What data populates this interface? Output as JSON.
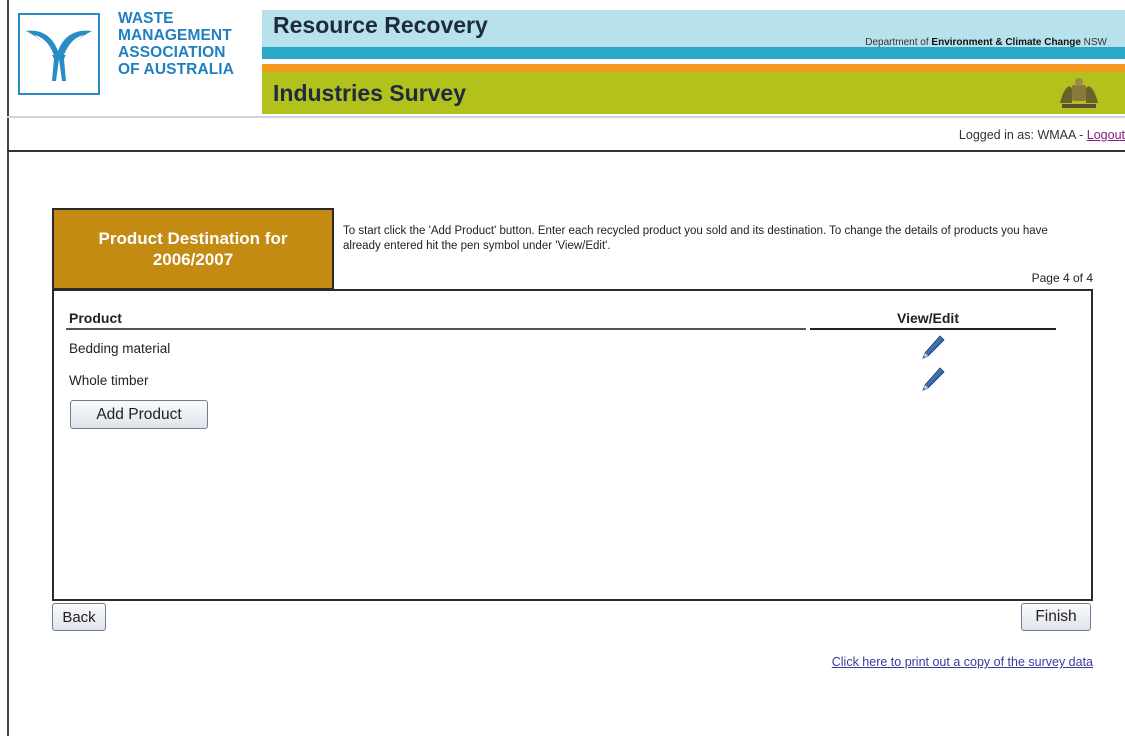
{
  "header": {
    "org_name_lines": [
      "WASTE",
      "MANAGEMENT",
      "ASSOCIATION",
      "OF AUSTRALIA"
    ],
    "title_top": "Resource Recovery",
    "title_bottom": "Industries Survey",
    "dept_prefix": "Department of ",
    "dept_bold": "Environment & Climate Change",
    "dept_suffix": " NSW",
    "logo_icon": "wmaa-logo-icon",
    "crest_icon": "nsw-crest-icon"
  },
  "session": {
    "logged_in_prefix": "Logged in as: WMAA - ",
    "logout_label": "Logout"
  },
  "panel": {
    "title": "Product Destination for 2006/2007",
    "instructions": "To start click the 'Add Product' button. Enter each recycled product you sold and its destination. To change the details of products you have already entered hit the pen symbol under 'View/Edit'.",
    "page_indicator": "Page 4 of 4"
  },
  "table": {
    "columns": [
      "Product",
      "View/Edit"
    ],
    "rows": [
      {
        "product": "Bedding material",
        "action_icon": "pen-icon"
      },
      {
        "product": "Whole timber",
        "action_icon": "pen-icon"
      }
    ]
  },
  "buttons": {
    "add_product": "Add Product",
    "back": "Back",
    "finish": "Finish"
  },
  "footer": {
    "print_link": "Click here to print out a copy of the survey data"
  },
  "colors": {
    "title_box": "#c38b12",
    "band_top": "#b7e2ec",
    "band_teal": "#2ba8c7",
    "band_orange": "#f39a1e",
    "band_olive": "#b3c11c",
    "org_blue": "#1f7fc1"
  }
}
